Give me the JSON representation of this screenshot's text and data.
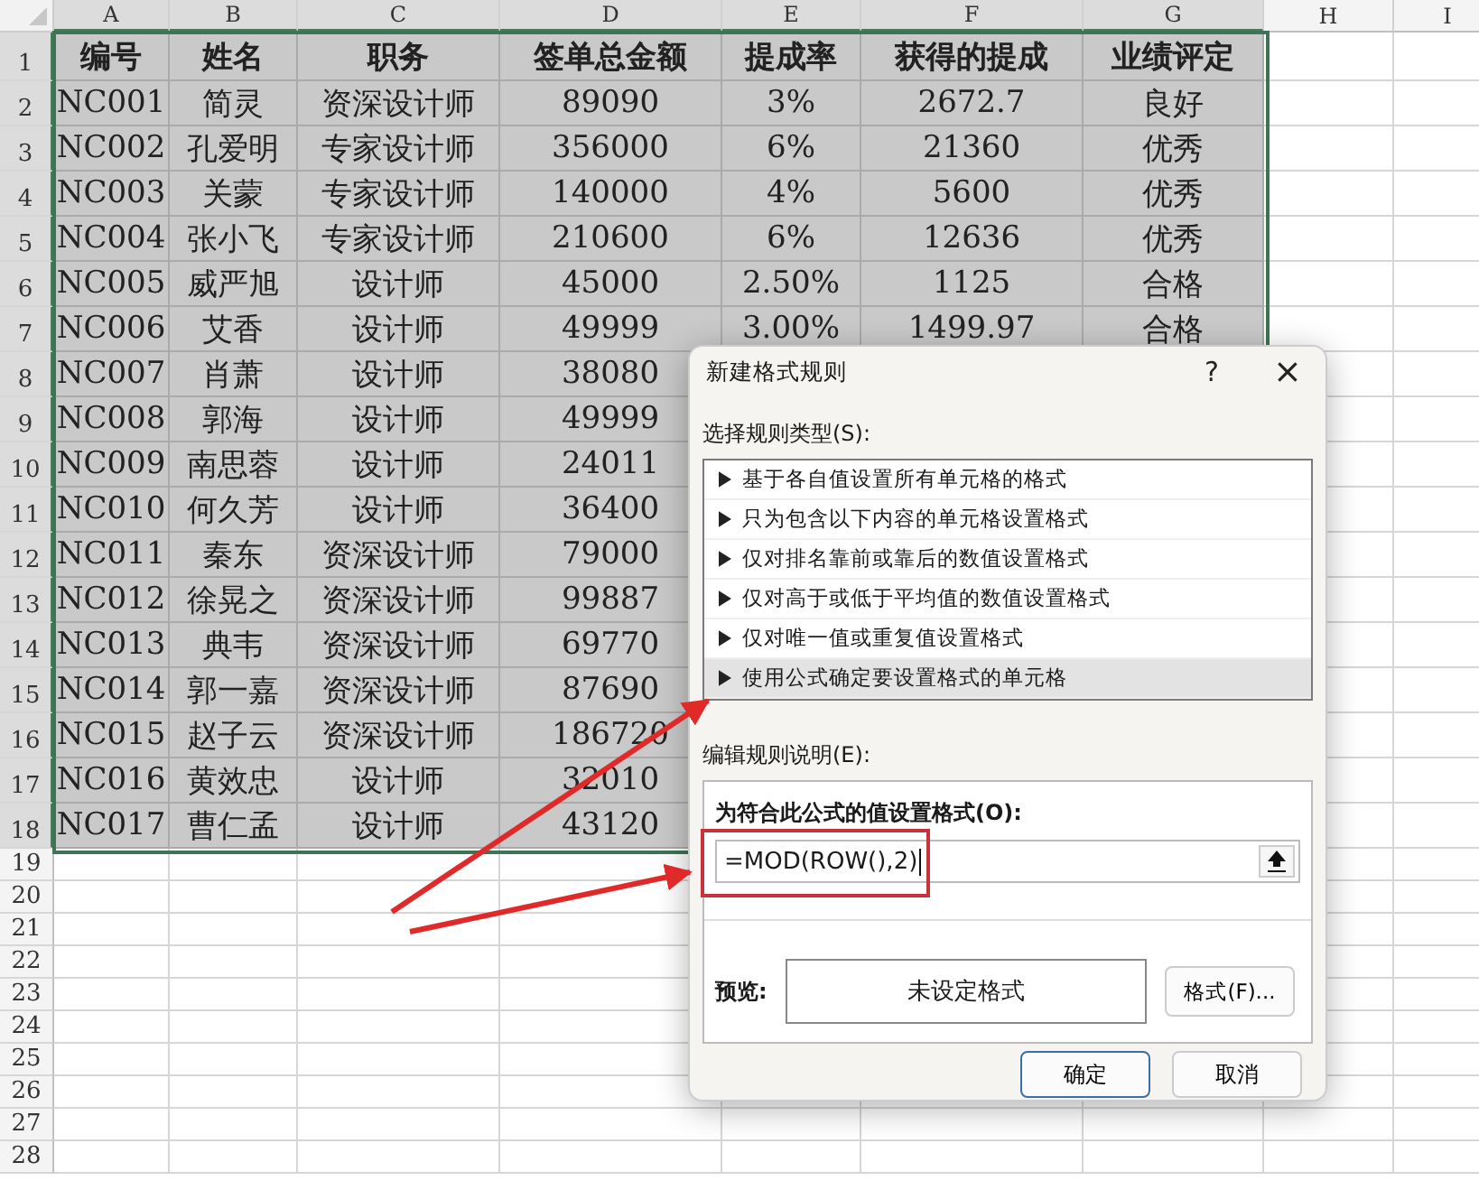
{
  "sheet": {
    "columns": [
      {
        "label": "A",
        "selected": true
      },
      {
        "label": "B",
        "selected": true
      },
      {
        "label": "C",
        "selected": true
      },
      {
        "label": "D",
        "selected": true
      },
      {
        "label": "E",
        "selected": true
      },
      {
        "label": "F",
        "selected": true
      },
      {
        "label": "G",
        "selected": true
      },
      {
        "label": "H",
        "selected": false
      },
      {
        "label": "I",
        "selected": false
      }
    ],
    "rows": [
      {
        "number": "1",
        "kind": "header",
        "selected": true,
        "cells": [
          "编号",
          "姓名",
          "职务",
          "签单总金额",
          "提成率",
          "获得的提成",
          "业绩评定"
        ]
      },
      {
        "number": "2",
        "kind": "data",
        "selected": true,
        "cells": [
          "NC001",
          "简灵",
          "资深设计师",
          "89090",
          "3%",
          "2672.7",
          "良好"
        ]
      },
      {
        "number": "3",
        "kind": "data",
        "selected": true,
        "cells": [
          "NC002",
          "孔爱明",
          "专家设计师",
          "356000",
          "6%",
          "21360",
          "优秀"
        ]
      },
      {
        "number": "4",
        "kind": "data",
        "selected": true,
        "cells": [
          "NC003",
          "关蒙",
          "专家设计师",
          "140000",
          "4%",
          "5600",
          "优秀"
        ]
      },
      {
        "number": "5",
        "kind": "data",
        "selected": true,
        "cells": [
          "NC004",
          "张小飞",
          "专家设计师",
          "210600",
          "6%",
          "12636",
          "优秀"
        ]
      },
      {
        "number": "6",
        "kind": "data",
        "selected": true,
        "cells": [
          "NC005",
          "威严旭",
          "设计师",
          "45000",
          "2.50%",
          "1125",
          "合格"
        ]
      },
      {
        "number": "7",
        "kind": "data",
        "selected": true,
        "cells": [
          "NC006",
          "艾香",
          "设计师",
          "49999",
          "3.00%",
          "1499.97",
          "合格"
        ]
      },
      {
        "number": "8",
        "kind": "data",
        "selected": true,
        "cells": [
          "NC007",
          "肖萧",
          "设计师",
          "38080"
        ]
      },
      {
        "number": "9",
        "kind": "data",
        "selected": true,
        "cells": [
          "NC008",
          "郭海",
          "设计师",
          "49999"
        ]
      },
      {
        "number": "10",
        "kind": "data",
        "selected": true,
        "cells": [
          "NC009",
          "南思蓉",
          "设计师",
          "24011"
        ]
      },
      {
        "number": "11",
        "kind": "data",
        "selected": true,
        "cells": [
          "NC010",
          "何久芳",
          "设计师",
          "36400"
        ]
      },
      {
        "number": "12",
        "kind": "data",
        "selected": true,
        "cells": [
          "NC011",
          "秦东",
          "资深设计师",
          "79000"
        ]
      },
      {
        "number": "13",
        "kind": "data",
        "selected": true,
        "cells": [
          "NC012",
          "徐晃之",
          "资深设计师",
          "99887"
        ]
      },
      {
        "number": "14",
        "kind": "data",
        "selected": true,
        "cells": [
          "NC013",
          "典韦",
          "资深设计师",
          "69770"
        ]
      },
      {
        "number": "15",
        "kind": "data",
        "selected": true,
        "cells": [
          "NC014",
          "郭一嘉",
          "资深设计师",
          "87690"
        ]
      },
      {
        "number": "16",
        "kind": "data",
        "selected": true,
        "cells": [
          "NC015",
          "赵子云",
          "资深设计师",
          "186720"
        ]
      },
      {
        "number": "17",
        "kind": "data",
        "selected": true,
        "cells": [
          "NC016",
          "黄效忠",
          "设计师",
          "32010"
        ]
      },
      {
        "number": "18",
        "kind": "data",
        "selected": true,
        "cells": [
          "NC017",
          "曹仁孟",
          "设计师",
          "43120"
        ]
      },
      {
        "number": "19",
        "kind": "data",
        "selected": false,
        "cells": []
      },
      {
        "number": "20",
        "kind": "data",
        "selected": false,
        "cells": []
      },
      {
        "number": "21",
        "kind": "data",
        "selected": false,
        "cells": []
      },
      {
        "number": "22",
        "kind": "data",
        "selected": false,
        "cells": []
      },
      {
        "number": "23",
        "kind": "data",
        "selected": false,
        "cells": []
      },
      {
        "number": "24",
        "kind": "data",
        "selected": false,
        "cells": []
      },
      {
        "number": "25",
        "kind": "data",
        "selected": false,
        "cells": []
      },
      {
        "number": "26",
        "kind": "data",
        "selected": false,
        "cells": []
      },
      {
        "number": "27",
        "kind": "data",
        "selected": false,
        "cells": []
      },
      {
        "number": "28",
        "kind": "data",
        "selected": false,
        "cells": []
      }
    ]
  },
  "dialog": {
    "title": "新建格式规则",
    "help": "?",
    "close": "×",
    "rule_type_label": "选择规则类型(S):",
    "rule_types": [
      {
        "label": "基于各自值设置所有单元格的格式",
        "selected": false
      },
      {
        "label": "只为包含以下内容的单元格设置格式",
        "selected": false
      },
      {
        "label": "仅对排名靠前或靠后的数值设置格式",
        "selected": false
      },
      {
        "label": "仅对高于或低于平均值的数值设置格式",
        "selected": false
      },
      {
        "label": "仅对唯一值或重复值设置格式",
        "selected": false
      },
      {
        "label": "使用公式确定要设置格式的单元格",
        "selected": true
      }
    ],
    "description_label": "编辑规则说明(E):",
    "formula_label": "为符合此公式的值设置格式(O):",
    "formula_value": "=MOD(ROW(),2)",
    "preview_label": "预览:",
    "preview_text": "未设定格式",
    "format_button": "格式(F)...",
    "buttons": [
      {
        "label": "确定",
        "kind": "default"
      },
      {
        "label": "取消",
        "kind": "normal"
      }
    ]
  }
}
